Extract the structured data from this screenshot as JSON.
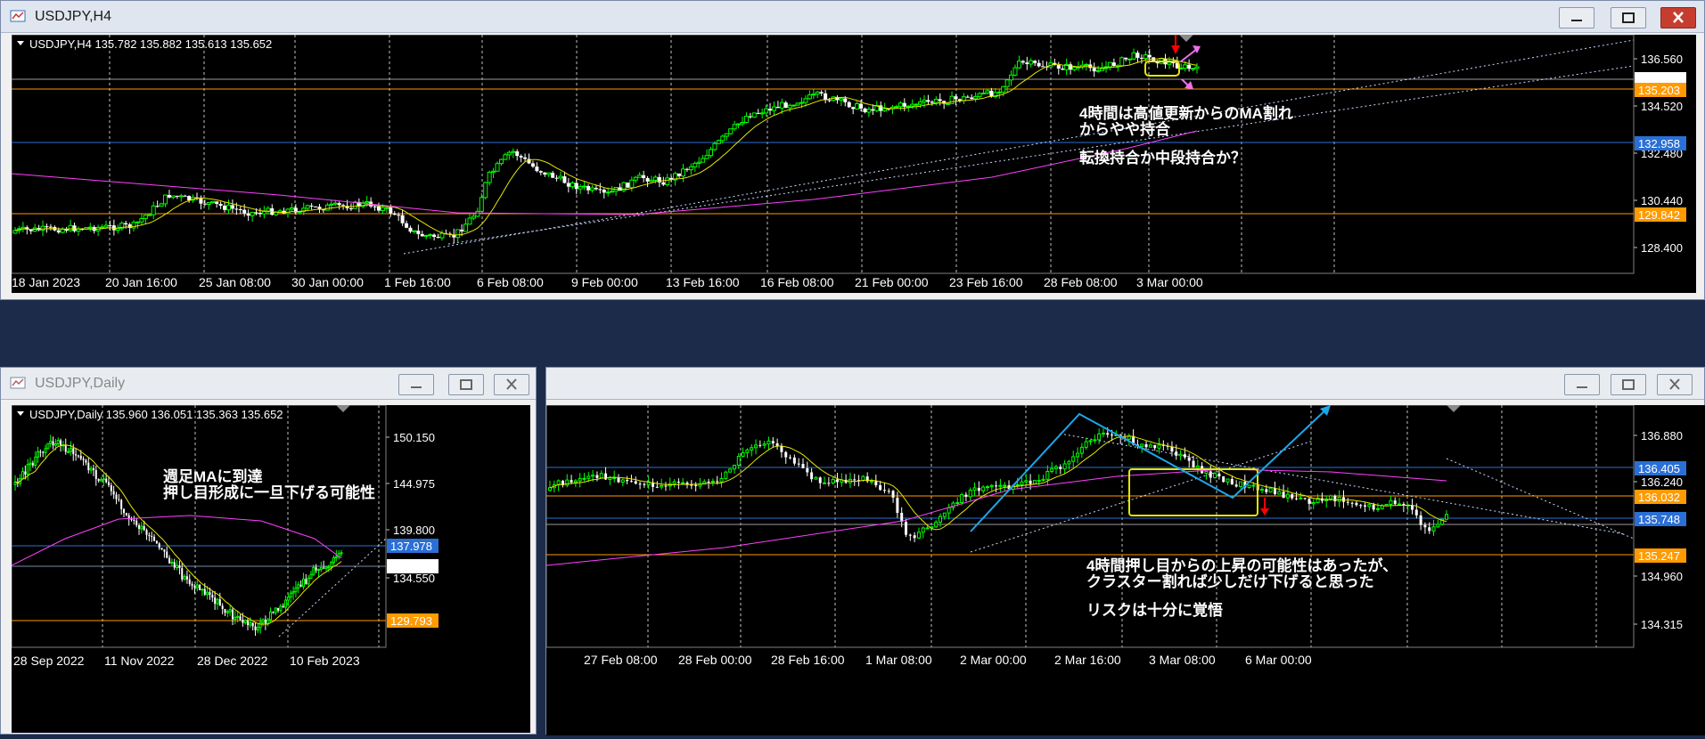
{
  "colors": {
    "bull": "#00ff00",
    "bear": "#ffffff",
    "ma_short": "#e6e600",
    "ma_long": "#ff40ff",
    "hline_orange": "#ff9a00",
    "hline_blue": "#2a6fd6",
    "trend_cyan": "#1ea6e8",
    "highlight_yellow": "#e6e600",
    "arrow_red": "#ff0000",
    "arrow_pink": "#ee70ee"
  },
  "icons": {
    "window": "chart-window-icon",
    "minimize": "minimize-icon",
    "restore": "restore-icon",
    "close": "close-icon"
  },
  "h4": {
    "title": "USDJPY,H4",
    "header": "USDJPY,H4  135.782 135.882 135.613 135.652",
    "y_ticks": [
      "136.560",
      "134.520",
      "132.480",
      "130.440",
      "128.400"
    ],
    "price_tags": [
      "135.652",
      "135.203",
      "132.958",
      "129.842"
    ],
    "x_labels": [
      "18 Jan 2023",
      "20 Jan 16:00",
      "25 Jan 08:00",
      "30 Jan 00:00",
      "1 Feb 16:00",
      "6 Feb 08:00",
      "9 Feb 00:00",
      "13 Feb 16:00",
      "16 Feb 08:00",
      "21 Feb 00:00",
      "23 Feb 16:00",
      "28 Feb 08:00",
      "3 Mar 00:00"
    ],
    "notes": [
      "4時間は高値更新からのMA割れ",
      "からやや持合",
      "転換持合か中段持合か？"
    ]
  },
  "daily": {
    "title": "USDJPY,Daily",
    "header": "USDJPY,Daily  135.960 136.051 135.363 135.652",
    "y_ticks": [
      "150.150",
      "144.975",
      "139.800",
      "134.550"
    ],
    "price_tags": [
      "137.978",
      "135.652",
      "129.793"
    ],
    "x_labels": [
      "28 Sep 2022",
      "11 Nov 2022",
      "28 Dec 2022",
      "10 Feb 2023"
    ],
    "notes": [
      "週足MAに到達",
      "押し目形成に一旦下げる可能性"
    ]
  },
  "m30": {
    "y_ticks": [
      "136.880",
      "136.240",
      "134.960",
      "134.315"
    ],
    "price_tags": [
      "136.405",
      "136.032",
      "135.748",
      "135.247"
    ],
    "x_labels": [
      "27 Feb 08:00",
      "28 Feb 00:00",
      "28 Feb 16:00",
      "1 Mar 08:00",
      "2 Mar 00:00",
      "2 Mar 16:00",
      "3 Mar 08:00",
      "6 Mar 00:00"
    ],
    "notes": [
      "4時間押し目からの上昇の可能性はあったが、",
      "クラスター割れば少しだけ下げると思った",
      "リスクは十分に覚悟"
    ]
  }
}
